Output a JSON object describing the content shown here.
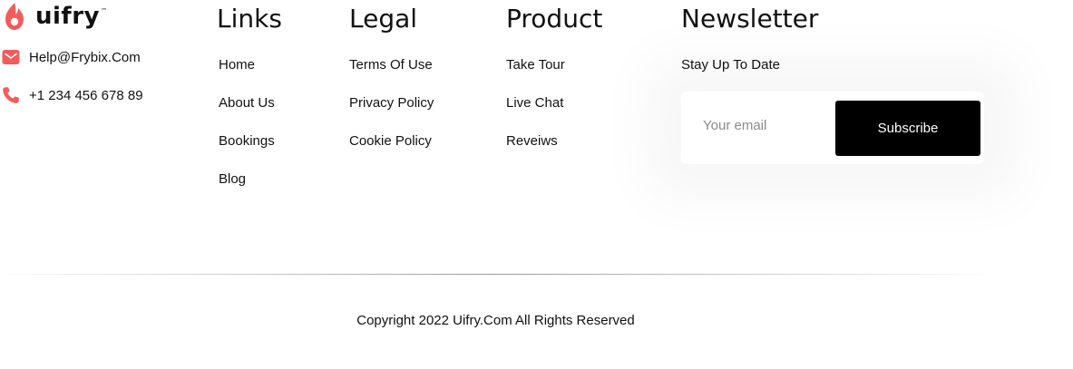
{
  "brand": {
    "name": "uifry",
    "trademark": "™",
    "icon": "flame-icon",
    "accent_color": "#f25c5c"
  },
  "contact": {
    "email": {
      "icon": "mail-icon",
      "text": "Help@Frybix.Com"
    },
    "phone": {
      "icon": "phone-icon",
      "text": "+1 234 456 678 89"
    }
  },
  "links": {
    "heading": "Links",
    "items": [
      "Home",
      "About Us",
      "Bookings",
      "Blog"
    ]
  },
  "legal": {
    "heading": "Legal",
    "items": [
      "Terms Of Use",
      "Privacy Policy",
      "Cookie Policy"
    ]
  },
  "product": {
    "heading": "Product",
    "items": [
      "Take Tour",
      "Live Chat",
      "Reveiws"
    ]
  },
  "newsletter": {
    "heading": "Newsletter",
    "subheading": "Stay Up To Date",
    "email_placeholder": "Your email",
    "subscribe_label": "Subscribe"
  },
  "copyright": "Copyright 2022 Uifry.Com All Rights Reserved"
}
